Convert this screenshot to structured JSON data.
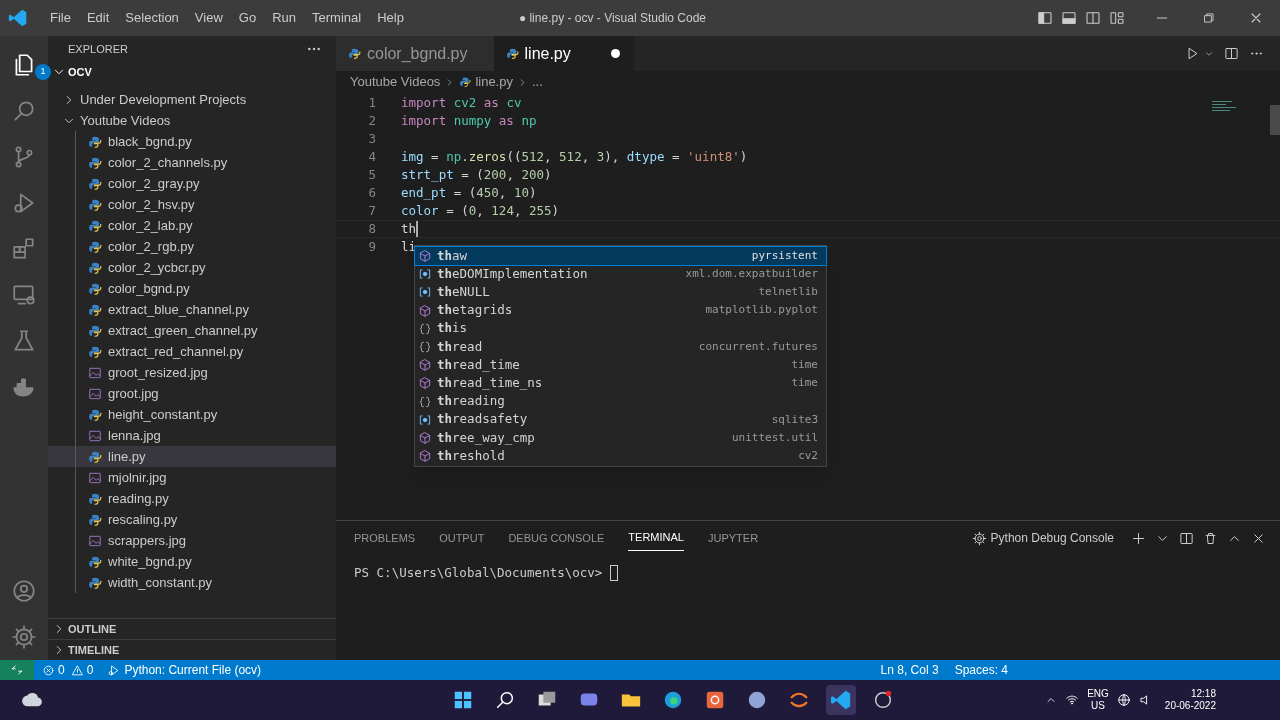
{
  "menu": [
    "File",
    "Edit",
    "Selection",
    "View",
    "Go",
    "Run",
    "Terminal",
    "Help"
  ],
  "window_title": "● line.py - ocv - Visual Studio Code",
  "activity_badge": "1",
  "explorer": {
    "title": "EXPLORER",
    "root": "OCV",
    "tree": [
      {
        "label": "Under Development Projects",
        "kind": "folder",
        "expanded": false,
        "selected": false
      },
      {
        "label": "Youtube Videos",
        "kind": "folder",
        "expanded": true,
        "selected": false,
        "children": [
          {
            "label": "black_bgnd.py",
            "kind": "python",
            "selected": false
          },
          {
            "label": "color_2_channels.py",
            "kind": "python",
            "selected": false
          },
          {
            "label": "color_2_gray.py",
            "kind": "python",
            "selected": false
          },
          {
            "label": "color_2_hsv.py",
            "kind": "python",
            "selected": false
          },
          {
            "label": "color_2_lab.py",
            "kind": "python",
            "selected": false
          },
          {
            "label": "color_2_rgb.py",
            "kind": "python",
            "selected": false
          },
          {
            "label": "color_2_ycbcr.py",
            "kind": "python",
            "selected": false
          },
          {
            "label": "color_bgnd.py",
            "kind": "python",
            "selected": false
          },
          {
            "label": "extract_blue_channel.py",
            "kind": "python",
            "selected": false
          },
          {
            "label": "extract_green_channel.py",
            "kind": "python",
            "selected": false
          },
          {
            "label": "extract_red_channel.py",
            "kind": "python",
            "selected": false
          },
          {
            "label": "groot_resized.jpg",
            "kind": "image",
            "selected": false
          },
          {
            "label": "groot.jpg",
            "kind": "image",
            "selected": false
          },
          {
            "label": "height_constant.py",
            "kind": "python",
            "selected": false
          },
          {
            "label": "lenna.jpg",
            "kind": "image",
            "selected": false
          },
          {
            "label": "line.py",
            "kind": "python",
            "selected": true
          },
          {
            "label": "mjolnir.jpg",
            "kind": "image",
            "selected": false
          },
          {
            "label": "reading.py",
            "kind": "python",
            "selected": false
          },
          {
            "label": "rescaling.py",
            "kind": "python",
            "selected": false
          },
          {
            "label": "scrappers.jpg",
            "kind": "image",
            "selected": false
          },
          {
            "label": "white_bgnd.py",
            "kind": "python",
            "selected": false
          },
          {
            "label": "width_constant.py",
            "kind": "python",
            "selected": false
          }
        ]
      }
    ],
    "sections": [
      "OUTLINE",
      "TIMELINE"
    ]
  },
  "tabs": [
    {
      "label": "color_bgnd.py",
      "selected": false,
      "modified": false
    },
    {
      "label": "line.py",
      "selected": true,
      "modified": true
    }
  ],
  "breadcrumb": [
    "Youtube Videos",
    "line.py",
    "..."
  ],
  "code": [
    {
      "number": "1",
      "tokens": [
        {
          "text": "import ",
          "kind": "keyword"
        },
        {
          "text": "cv2 ",
          "kind": "module"
        },
        {
          "text": "as ",
          "kind": "keyword"
        },
        {
          "text": "cv",
          "kind": "module"
        }
      ]
    },
    {
      "number": "2",
      "tokens": [
        {
          "text": "import ",
          "kind": "keyword"
        },
        {
          "text": "numpy ",
          "kind": "module"
        },
        {
          "text": "as ",
          "kind": "keyword"
        },
        {
          "text": "np",
          "kind": "module"
        }
      ]
    },
    {
      "number": "3"
    },
    {
      "number": "4",
      "tokens": [
        {
          "text": "img",
          "kind": "variable"
        },
        {
          "text": " = ",
          "kind": "plain"
        },
        {
          "text": "np",
          "kind": "module"
        },
        {
          "text": ".",
          "kind": "plain"
        },
        {
          "text": "zeros",
          "kind": "function"
        },
        {
          "text": "((",
          "kind": "plain"
        },
        {
          "text": "512",
          "kind": "number"
        },
        {
          "text": ", ",
          "kind": "plain"
        },
        {
          "text": "512",
          "kind": "number"
        },
        {
          "text": ", ",
          "kind": "plain"
        },
        {
          "text": "3",
          "kind": "number"
        },
        {
          "text": "), ",
          "kind": "plain"
        },
        {
          "text": "dtype",
          "kind": "variable"
        },
        {
          "text": " = ",
          "kind": "plain"
        },
        {
          "text": "'uint8'",
          "kind": "string"
        },
        {
          "text": ")",
          "kind": "plain"
        }
      ]
    },
    {
      "number": "5",
      "tokens": [
        {
          "text": "strt_pt",
          "kind": "variable"
        },
        {
          "text": " = (",
          "kind": "plain"
        },
        {
          "text": "200",
          "kind": "number"
        },
        {
          "text": ", ",
          "kind": "plain"
        },
        {
          "text": "200",
          "kind": "number"
        },
        {
          "text": ")",
          "kind": "plain"
        }
      ]
    },
    {
      "number": "6",
      "tokens": [
        {
          "text": "end_pt",
          "kind": "variable"
        },
        {
          "text": " = (",
          "kind": "plain"
        },
        {
          "text": "450",
          "kind": "number"
        },
        {
          "text": ", ",
          "kind": "plain"
        },
        {
          "text": "10",
          "kind": "number"
        },
        {
          "text": ")",
          "kind": "plain"
        }
      ]
    },
    {
      "number": "7",
      "tokens": [
        {
          "text": "color",
          "kind": "variable"
        },
        {
          "text": " = (",
          "kind": "plain"
        },
        {
          "text": "0",
          "kind": "number"
        },
        {
          "text": ", ",
          "kind": "plain"
        },
        {
          "text": "124",
          "kind": "number"
        },
        {
          "text": ", ",
          "kind": "plain"
        },
        {
          "text": "255",
          "kind": "number"
        },
        {
          "text": ")",
          "kind": "plain"
        }
      ]
    },
    {
      "number": "8",
      "tokens": [
        {
          "text": "th",
          "kind": "plain"
        }
      ],
      "cursor": true
    },
    {
      "number": "9",
      "tokens": [
        {
          "text": "li",
          "kind": "plain"
        }
      ]
    }
  ],
  "suggestions": [
    {
      "label": "**th**aw",
      "detail": "pyrsistent",
      "kind": "function",
      "selected": true
    },
    {
      "label": "**th**eDOMImplementation",
      "detail": "xml.dom.expatbuilder",
      "kind": "variable",
      "selected": false
    },
    {
      "label": "**th**eNULL",
      "detail": "telnetlib",
      "kind": "variable",
      "selected": false
    },
    {
      "label": "**th**etagrids",
      "detail": "matplotlib.pyplot",
      "kind": "function",
      "selected": false
    },
    {
      "label": "**th**is",
      "kind": "module",
      "selected": false
    },
    {
      "label": "**th**read",
      "detail": "concurrent.futures",
      "kind": "module",
      "selected": false
    },
    {
      "label": "**th**read_time",
      "detail": "time",
      "kind": "function",
      "selected": false
    },
    {
      "label": "**th**read_time_ns",
      "detail": "time",
      "kind": "function",
      "selected": false
    },
    {
      "label": "**th**reading",
      "kind": "module",
      "selected": false
    },
    {
      "label": "**th**readsafety",
      "detail": "sqlite3",
      "kind": "variable",
      "selected": false
    },
    {
      "label": "**th**ree_way_cmp",
      "detail": "unittest.util",
      "kind": "function",
      "selected": false
    },
    {
      "label": "**th**reshold",
      "detail": "cv2",
      "kind": "function",
      "selected": false
    }
  ],
  "panel": {
    "tabs": [
      {
        "label": "PROBLEMS",
        "selected": false
      },
      {
        "label": "OUTPUT",
        "selected": false
      },
      {
        "label": "DEBUG CONSOLE",
        "selected": false
      },
      {
        "label": "TERMINAL",
        "selected": true
      },
      {
        "label": "JUPYTER",
        "selected": false
      }
    ],
    "terminal_name": "Python Debug Console",
    "prompt": "PS C:\\Users\\Global\\Documents\\ocv> "
  },
  "status_bar": {
    "errors": "0",
    "warnings": "0",
    "run_config": "Python: Current File (ocv)",
    "position": "Ln 8, Col 3",
    "indent": "Spaces: 4"
  },
  "taskbar": {
    "language": "ENG",
    "region": "US",
    "time": "12:18",
    "date": "20-06-2022"
  }
}
